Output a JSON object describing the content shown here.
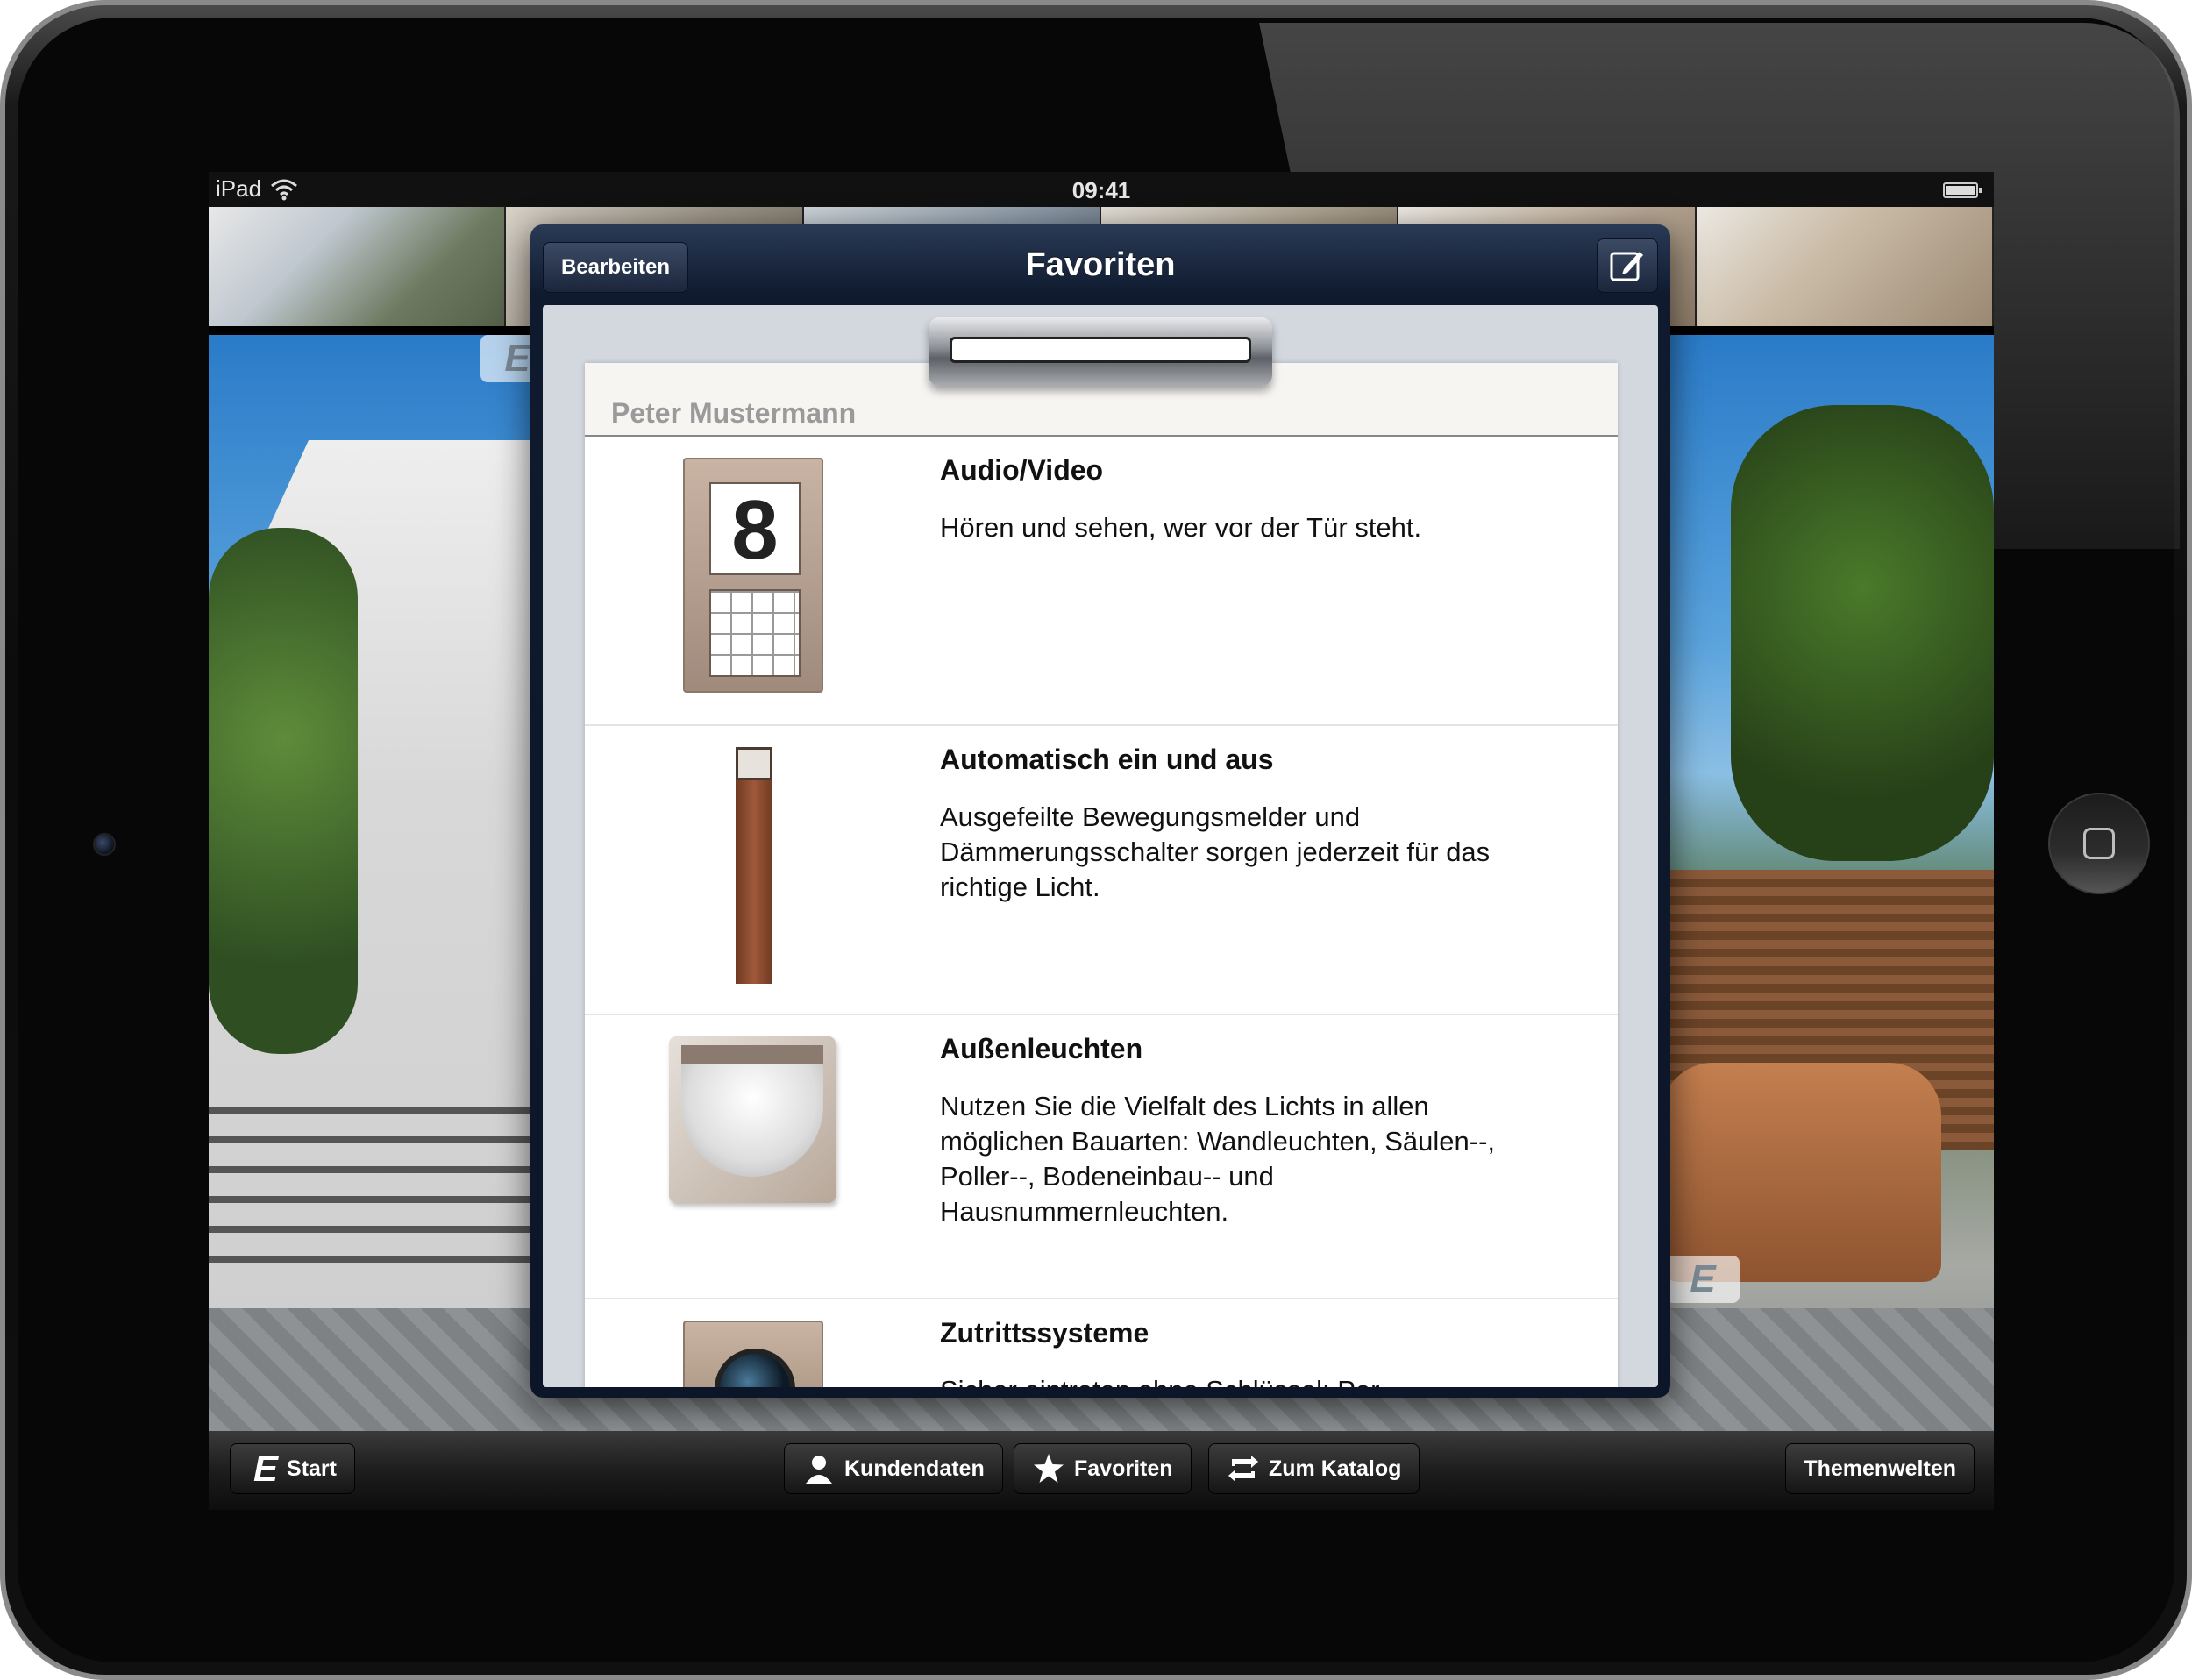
{
  "status_bar": {
    "device": "iPad",
    "time": "09:41"
  },
  "popover": {
    "edit_label": "Bearbeiten",
    "title": "Favoriten",
    "customer_name": "Peter Mustermann",
    "items": [
      {
        "title": "Audio/Video",
        "description": "Hören und sehen, wer vor der Tür steht."
      },
      {
        "title": "Automatisch ein und aus",
        "description": "Ausgefeilte Bewegungsmelder und Dämmerungsschalter sorgen jederzeit für das richtige Licht."
      },
      {
        "title": "Außenleuchten",
        "description": "Nutzen Sie die Vielfalt des Lichts in allen möglichen Bauarten: Wandleuchten, Säulen--, Poller--, Bodeneinbau-- und Hausnummernleuchten."
      },
      {
        "title": "Zutrittssysteme",
        "description": "Sicher eintreten ohne Schlüssel: Per"
      }
    ],
    "audio_panel_number": "8"
  },
  "toolbar": {
    "start_label": "Start",
    "kundendaten_label": "Kundendaten",
    "favoriten_label": "Favoriten",
    "katalog_label": "Zum Katalog",
    "themenwelten_label": "Themenwelten"
  },
  "badges": {
    "e_left": "E",
    "e_right": "E"
  },
  "icons": {
    "wifi": "wifi-icon",
    "battery": "battery-icon",
    "compose": "compose-icon",
    "user": "user-icon",
    "star": "star-icon",
    "sync": "sync-icon",
    "e_logo": "e-logo-icon"
  },
  "colors": {
    "nav_dark": "#0f1a2e",
    "toolbar": "#1d1d1d",
    "text": "#111111",
    "muted": "#9a9a9a"
  }
}
